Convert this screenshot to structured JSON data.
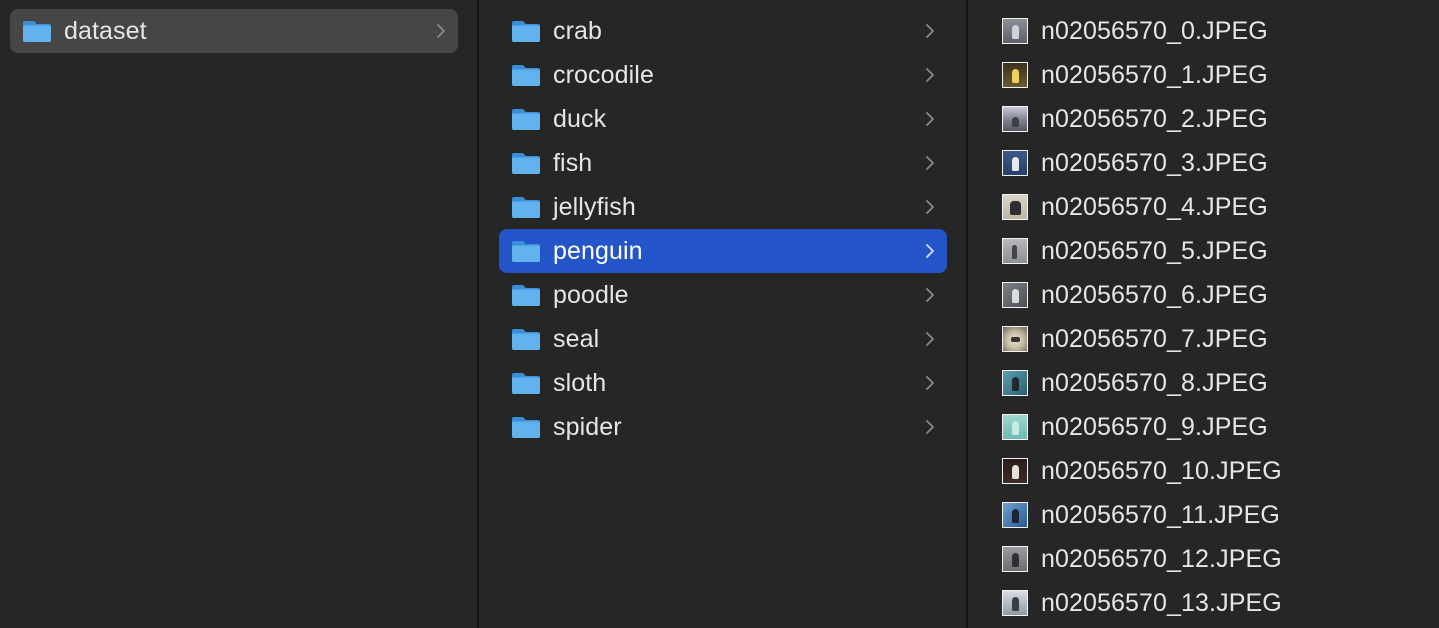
{
  "column1": {
    "items": [
      {
        "label": "dataset",
        "selected": true
      }
    ]
  },
  "column2": {
    "items": [
      {
        "label": "crab"
      },
      {
        "label": "crocodile"
      },
      {
        "label": "duck"
      },
      {
        "label": "fish"
      },
      {
        "label": "jellyfish"
      },
      {
        "label": "penguin",
        "selected": true
      },
      {
        "label": "poodle"
      },
      {
        "label": "seal"
      },
      {
        "label": "sloth"
      },
      {
        "label": "spider"
      }
    ]
  },
  "column3": {
    "files": [
      {
        "name": "n02056570_0.JPEG"
      },
      {
        "name": "n02056570_1.JPEG"
      },
      {
        "name": "n02056570_2.JPEG"
      },
      {
        "name": "n02056570_3.JPEG"
      },
      {
        "name": "n02056570_4.JPEG"
      },
      {
        "name": "n02056570_5.JPEG"
      },
      {
        "name": "n02056570_6.JPEG"
      },
      {
        "name": "n02056570_7.JPEG"
      },
      {
        "name": "n02056570_8.JPEG"
      },
      {
        "name": "n02056570_9.JPEG"
      },
      {
        "name": "n02056570_10.JPEG"
      },
      {
        "name": "n02056570_11.JPEG"
      },
      {
        "name": "n02056570_12.JPEG"
      },
      {
        "name": "n02056570_13.JPEG"
      }
    ]
  },
  "colors": {
    "background": "#262626",
    "selected_active": "#2354c8",
    "selected_inactive": "#464646",
    "folder_blue": "#5aa9e6",
    "text": "#e6e6e6",
    "chevron": "#8a8a8a"
  },
  "icons": {
    "folder": "folder-icon",
    "chevron": "chevron-right-icon",
    "thumbnail": "image-thumbnail-icon"
  }
}
